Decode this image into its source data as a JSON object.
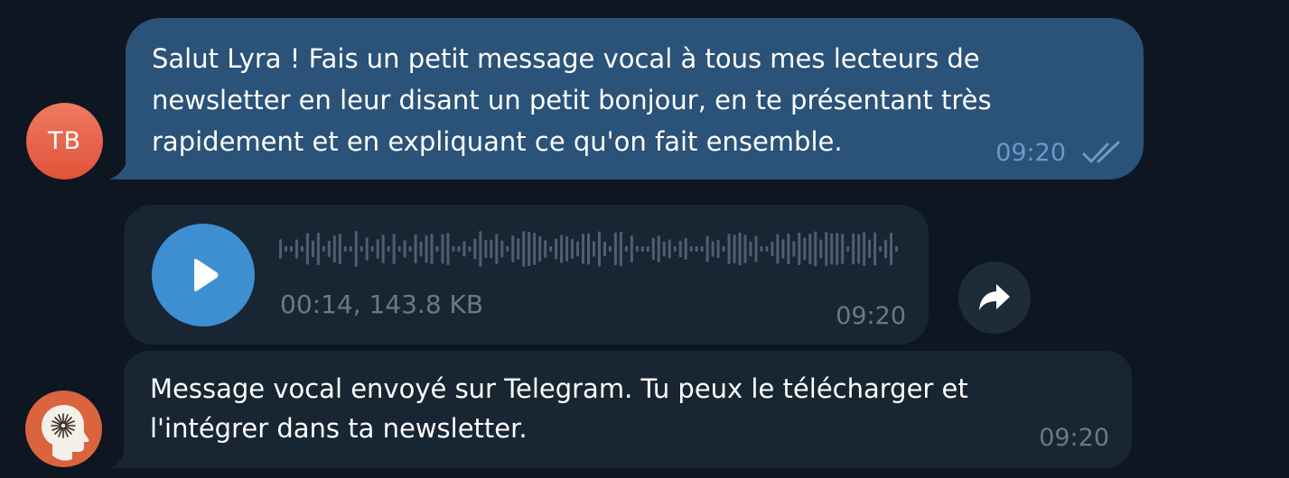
{
  "messages": [
    {
      "avatar_initials": "TB",
      "text": "Salut Lyra ! Fais un petit message vocal à tous mes lecteurs de\nnewsletter en leur disant un petit bonjour, en te présentant très\nrapidement et en expliquant ce qu'on fait ensemble.",
      "time": "09:20",
      "status_icon": "double-check-icon"
    },
    {
      "type": "voice",
      "meta": "00:14, 143.8 KB",
      "time": "09:20",
      "play_icon": "play-icon",
      "forward_icon": "forward-icon"
    },
    {
      "avatar_icon": "head-profile-icon",
      "text": "Message vocal envoyé sur Telegram. Tu peux le télécharger et\nl'intégrer dans ta newsletter.",
      "time": "09:20"
    }
  ],
  "colors": {
    "background": "#0e1621",
    "outgoing_bubble": "#2b5278",
    "incoming_bubble": "#182533",
    "accent": "#3d8fd1",
    "avatar_tb": "#e35a40",
    "avatar_bot": "#d9643d",
    "secondary_text": "#6c7883"
  }
}
